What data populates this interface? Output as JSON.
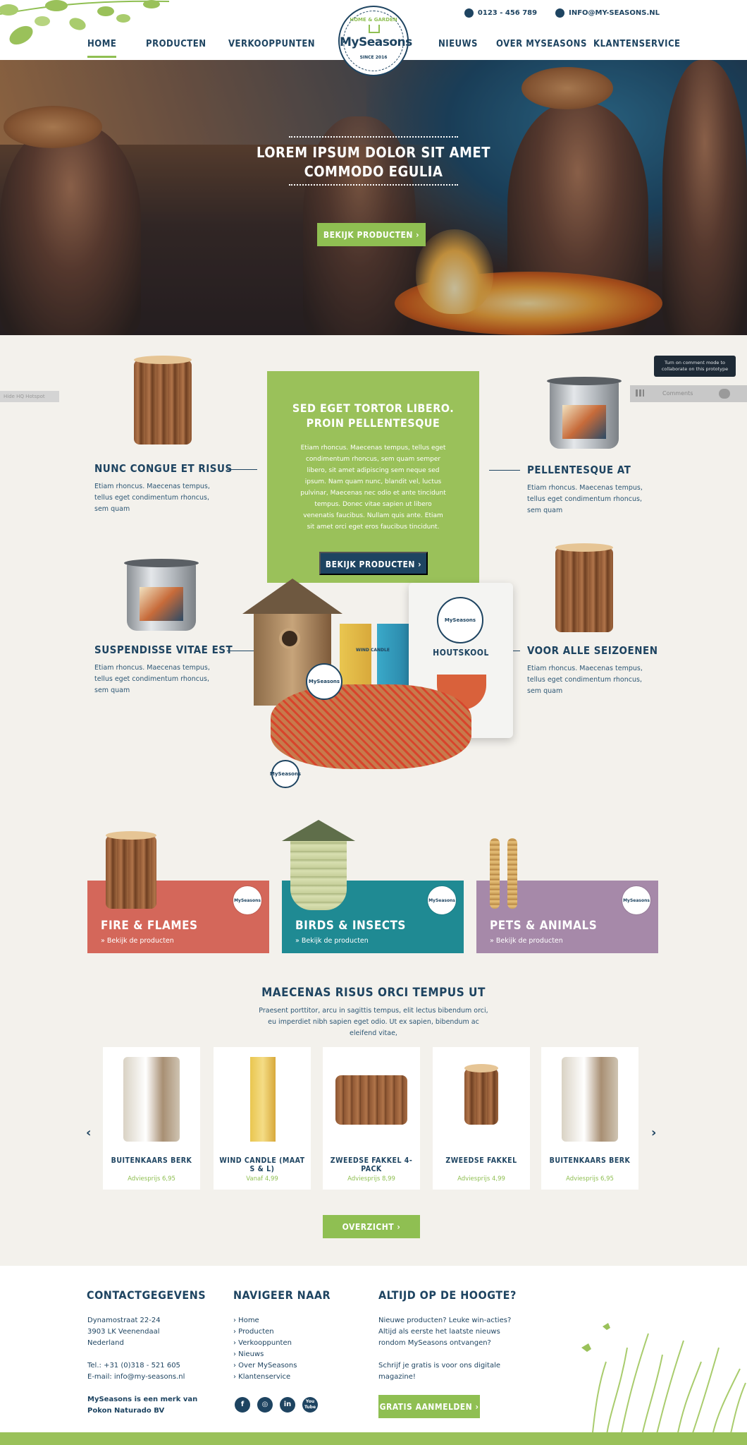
{
  "header": {
    "phone": "0123 - 456 789",
    "email": "INFO@MY-SEASONS.NL",
    "nav": [
      "HOME",
      "PRODUCTEN",
      "VERKOOPPUNTEN",
      "NIEUWS",
      "OVER MYSEASONS",
      "KLANTENSERVICE"
    ],
    "logo": {
      "top": "HOME & GARDEN",
      "name": "MySeasons",
      "since": "SINCE 2016"
    }
  },
  "hero": {
    "title_line1": "LOREM IPSUM DOLOR SIT AMET",
    "title_line2": "COMMODO EGULIA",
    "button": "BEKIJK PRODUCTEN ›"
  },
  "prototype": {
    "tooltip": "Turn on comment mode to collaborate on this prototype",
    "comments": "Comments",
    "left_bar": "Hide HQ  Hotspot"
  },
  "feature": {
    "panel_title_line1": "SED EGET TORTOR LIBERO.",
    "panel_title_line2": "PROIN PELLENTESQUE",
    "panel_text": "Etiam rhoncus. Maecenas tempus, tellus eget condimentum rhoncus, sem quam semper libero, sit amet adipiscing sem neque sed ipsum. Nam quam nunc, blandit vel, luctus pulvinar, Maecenas nec odio et ante tincidunt tempus. Donec vitae sapien ut libero venenatis faucibus. Nullam quis ante. Etiam sit amet orci eget eros faucibus tincidunt.",
    "panel_button": "BEKIJK PRODUCTEN ›",
    "items": [
      {
        "title": "NUNC CONGUE ET RISUS",
        "text": "Etiam rhoncus. Maecenas tempus, tellus eget condimentum rhoncus, sem quam"
      },
      {
        "title": "PELLENTESQUE AT",
        "text": "Etiam rhoncus. Maecenas tempus, tellus eget condimentum rhoncus, sem quam"
      },
      {
        "title": "SUSPENDISSE VITAE EST",
        "text": "Etiam rhoncus. Maecenas tempus, tellus eget condimentum rhoncus, sem quam"
      },
      {
        "title": "VOOR ALLE SEIZOENEN",
        "text": "Etiam rhoncus. Maecenas tempus, tellus eget condimentum rhoncus, sem quam"
      }
    ],
    "bag_label": "HOUTSKOOL",
    "candle_label": "WIND CANDLE"
  },
  "categories": [
    {
      "title": "FIRE & FLAMES",
      "link": "» Bekijk de producten",
      "color": "#d4675a"
    },
    {
      "title": "BIRDS & INSECTS",
      "link": "» Bekijk de producten",
      "color": "#1f8a93"
    },
    {
      "title": "PETS & ANIMALS",
      "link": "» Bekijk de producten",
      "color": "#a689a9"
    }
  ],
  "products_section": {
    "title": "MAECENAS RISUS ORCI TEMPUS UT",
    "text": "Praesent porttitor, arcu in sagittis tempus, elit lectus bibendum orci, eu imperdiet nibh sapien eget odio. Ut ex sapien, bibendum ac eleifend vitae,",
    "products": [
      {
        "name": "BUITENKAARS BERK",
        "price": "Adviesprijs 6,95"
      },
      {
        "name": "WIND CANDLE (MAAT S & L)",
        "price": "Vanaf 4,99"
      },
      {
        "name": "ZWEEDSE FAKKEL 4-PACK",
        "price": "Adviesprijs 8,99"
      },
      {
        "name": "ZWEEDSE FAKKEL",
        "price": "Adviesprijs 4,99"
      },
      {
        "name": "BUITENKAARS BERK",
        "price": "Adviesprijs 6,95"
      }
    ],
    "button": "OVERZICHT ›"
  },
  "footer": {
    "contact": {
      "title": "CONTACTGEGEVENS",
      "address1": "Dynamostraat 22-24",
      "address2": "3903 LK  Veenendaal",
      "address3": "Nederland",
      "tel": "Tel.: +31 (0)318 - 521 605",
      "email": "E-mail: info@my-seasons.nl",
      "brand1": "MySeasons is een merk van",
      "brand2": "Pokon Naturado BV"
    },
    "nav": {
      "title": "NAVIGEER NAAR",
      "links": [
        "› Home",
        "› Producten",
        "› Verkooppunten",
        "› Nieuws",
        "› Over MySeasons",
        "› Klantenservice"
      ]
    },
    "social": [
      "f",
      "◎",
      "in",
      "You Tube"
    ],
    "news": {
      "title": "ALTIJD OP DE HOOGTE?",
      "text1": "Nieuwe producten? Leuke win-acties? Altijd als eerste het laatste nieuws rondom MySeasons ontvangen?",
      "text2": "Schrijf je gratis is voor ons digitale magazine!",
      "button": "GRATIS AANMELDEN ›"
    }
  },
  "colors": {
    "navy": "#1e4461",
    "green": "#8fbf52",
    "background": "#f3f1ec"
  }
}
